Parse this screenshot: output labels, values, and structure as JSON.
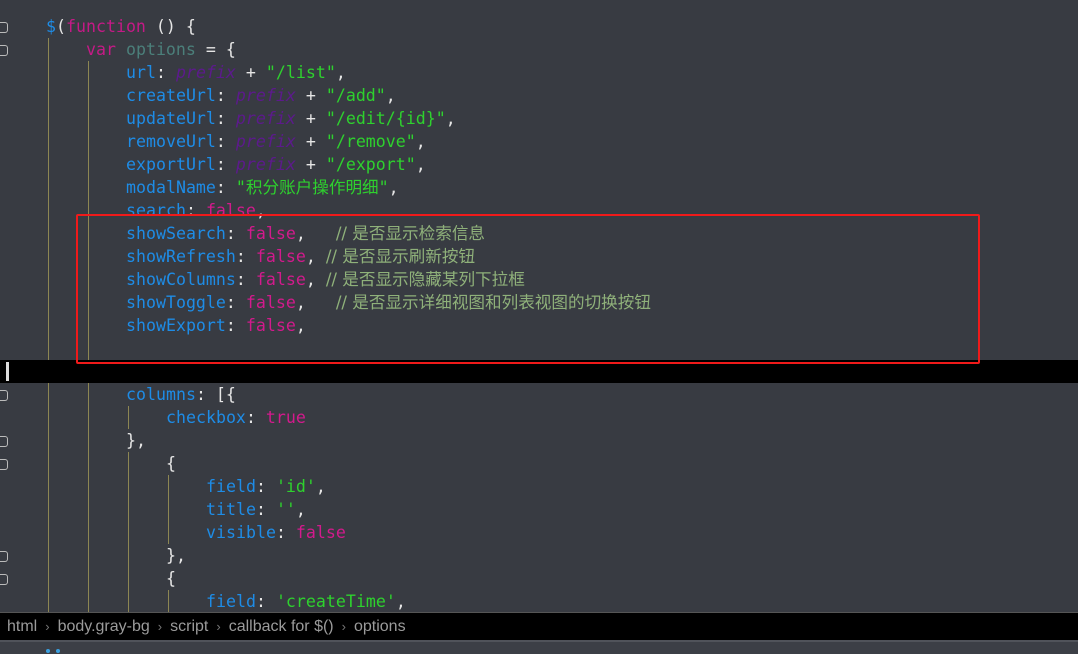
{
  "code": {
    "lines": [
      {
        "indent": 0,
        "fold": true,
        "tokens": [
          [
            "$",
            "p"
          ],
          [
            "(",
            "t"
          ],
          [
            "function",
            "k"
          ],
          [
            " () {",
            "t"
          ]
        ]
      },
      {
        "indent": 1,
        "fold": true,
        "tokens": [
          [
            "var ",
            "k"
          ],
          [
            "options",
            "o"
          ],
          [
            " = {",
            "t"
          ]
        ]
      },
      {
        "indent": 2,
        "tokens": [
          [
            "url",
            "p"
          ],
          [
            ": ",
            "t"
          ],
          [
            "prefix",
            "v"
          ],
          [
            " + ",
            "t"
          ],
          [
            "\"/list\"",
            "s"
          ],
          [
            ",",
            "t"
          ]
        ]
      },
      {
        "indent": 2,
        "tokens": [
          [
            "createUrl",
            "p"
          ],
          [
            ": ",
            "t"
          ],
          [
            "prefix",
            "v"
          ],
          [
            " + ",
            "t"
          ],
          [
            "\"/add\"",
            "s"
          ],
          [
            ",",
            "t"
          ]
        ]
      },
      {
        "indent": 2,
        "tokens": [
          [
            "updateUrl",
            "p"
          ],
          [
            ": ",
            "t"
          ],
          [
            "prefix",
            "v"
          ],
          [
            " + ",
            "t"
          ],
          [
            "\"/edit/{id}\"",
            "s"
          ],
          [
            ",",
            "t"
          ]
        ]
      },
      {
        "indent": 2,
        "tokens": [
          [
            "removeUrl",
            "p"
          ],
          [
            ": ",
            "t"
          ],
          [
            "prefix",
            "v"
          ],
          [
            " + ",
            "t"
          ],
          [
            "\"/remove\"",
            "s"
          ],
          [
            ",",
            "t"
          ]
        ]
      },
      {
        "indent": 2,
        "tokens": [
          [
            "exportUrl",
            "p"
          ],
          [
            ": ",
            "t"
          ],
          [
            "prefix",
            "v"
          ],
          [
            " + ",
            "t"
          ],
          [
            "\"/export\"",
            "s"
          ],
          [
            ",",
            "t"
          ]
        ]
      },
      {
        "indent": 2,
        "tokens": [
          [
            "modalName",
            "p"
          ],
          [
            ": ",
            "t"
          ],
          [
            "\"积分账户操作明细\"",
            "s"
          ],
          [
            ",",
            "t"
          ]
        ]
      },
      {
        "indent": 2,
        "tokens": [
          [
            "search",
            "p"
          ],
          [
            ": ",
            "t"
          ],
          [
            "false",
            "f"
          ],
          [
            ",",
            "t"
          ]
        ]
      },
      {
        "indent": 2,
        "tokens": [
          [
            "showSearch",
            "p"
          ],
          [
            ": ",
            "t"
          ],
          [
            "false",
            "f"
          ],
          [
            ",   ",
            "t"
          ],
          [
            "// 是否显示检索信息",
            "c"
          ]
        ]
      },
      {
        "indent": 2,
        "tokens": [
          [
            "showRefresh",
            "p"
          ],
          [
            ": ",
            "t"
          ],
          [
            "false",
            "f"
          ],
          [
            ", ",
            "t"
          ],
          [
            "// 是否显示刷新按钮",
            "c"
          ]
        ]
      },
      {
        "indent": 2,
        "tokens": [
          [
            "showColumns",
            "p"
          ],
          [
            ": ",
            "t"
          ],
          [
            "false",
            "f"
          ],
          [
            ", ",
            "t"
          ],
          [
            "// 是否显示隐藏某列下拉框",
            "c"
          ]
        ]
      },
      {
        "indent": 2,
        "tokens": [
          [
            "showToggle",
            "p"
          ],
          [
            ": ",
            "t"
          ],
          [
            "false",
            "f"
          ],
          [
            ",   ",
            "t"
          ],
          [
            "// 是否显示详细视图和列表视图的切换按钮",
            "c"
          ]
        ]
      },
      {
        "indent": 2,
        "tokens": [
          [
            "showExport",
            "p"
          ],
          [
            ": ",
            "t"
          ],
          [
            "false",
            "f"
          ],
          [
            ",",
            "t"
          ]
        ]
      },
      {
        "indent": 2,
        "tokens": []
      },
      {
        "indent": 0,
        "current": true,
        "tokens": []
      },
      {
        "indent": 2,
        "fold": true,
        "tokens": [
          [
            "columns",
            "p"
          ],
          [
            ": [{",
            "t"
          ]
        ]
      },
      {
        "indent": 3,
        "tokens": [
          [
            "checkbox",
            "p"
          ],
          [
            ": ",
            "t"
          ],
          [
            "true",
            "f"
          ]
        ]
      },
      {
        "indent": 2,
        "fold": true,
        "tokens": [
          [
            "},",
            "t"
          ]
        ]
      },
      {
        "indent": 3,
        "fold": true,
        "tokens": [
          [
            "{",
            "t"
          ]
        ]
      },
      {
        "indent": 4,
        "tokens": [
          [
            "field",
            "p"
          ],
          [
            ": ",
            "t"
          ],
          [
            "'id'",
            "s"
          ],
          [
            ",",
            "t"
          ]
        ]
      },
      {
        "indent": 4,
        "tokens": [
          [
            "title",
            "p"
          ],
          [
            ": ",
            "t"
          ],
          [
            "''",
            "s"
          ],
          [
            ",",
            "t"
          ]
        ]
      },
      {
        "indent": 4,
        "tokens": [
          [
            "visible",
            "p"
          ],
          [
            ": ",
            "t"
          ],
          [
            "false",
            "f"
          ]
        ]
      },
      {
        "indent": 3,
        "fold": true,
        "tokens": [
          [
            "},",
            "t"
          ]
        ]
      },
      {
        "indent": 3,
        "fold": true,
        "tokens": [
          [
            "{",
            "t"
          ]
        ]
      },
      {
        "indent": 4,
        "tokens": [
          [
            "field",
            "p"
          ],
          [
            ": ",
            "t"
          ],
          [
            "'createTime'",
            "s"
          ],
          [
            ",",
            "t"
          ]
        ]
      }
    ]
  },
  "breadcrumb": [
    "html",
    "body.gray-bg",
    "script",
    "callback for $()",
    "options"
  ],
  "breadcrumb_separator": "›",
  "colors": {
    "highlight_box": "#f01a1a",
    "keyword": "#c41a86",
    "property": "#1e8ce6",
    "string": "#2ed12e",
    "comment": "#8fb17a",
    "background": "#383b42"
  }
}
